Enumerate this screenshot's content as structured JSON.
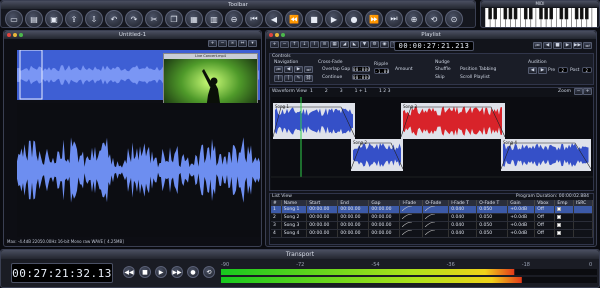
{
  "toolbar": {
    "title": "Toolbar",
    "icons": [
      "new-file",
      "open-file",
      "save",
      "export",
      "import",
      "undo",
      "redo",
      "cut",
      "copy",
      "paste",
      "delete",
      "back",
      "fast-back",
      "previous",
      "rewind",
      "stop",
      "play",
      "record",
      "fast-forward",
      "next",
      "forward",
      "loop",
      "zoom"
    ]
  },
  "midi": {
    "title": "MIDI"
  },
  "editor": {
    "title": "Untitled-1",
    "video_title": "Live Concert.mp4",
    "status": "Max: -4.4dB   22050.00Hz 16-bit Mono raw WAVE [ 4.25MB]"
  },
  "playlist": {
    "title": "Playlist",
    "time": "00:00:27:21.213",
    "controls": {
      "title": "Controls",
      "navigation": "Navigation",
      "crossfade": "Cross-Fade",
      "nudge": "Nudge",
      "audition": "Audition",
      "ripple": "Ripple",
      "overlap": "Overlap Gap",
      "continue": "Continue",
      "overlap_val": "00:000",
      "continue_val": "00:000",
      "gap_val": "-1.00",
      "amount": "Amount",
      "shuffle": "Shuffle",
      "repeat": "Repeat",
      "skip": "Skip",
      "position_tabbing": "Position Tabbing",
      "scroll_playlist": "Scroll Playlist",
      "preroll": "Pre",
      "postroll": "Post",
      "pre_val": "2",
      "post_val": "2"
    },
    "waveform_view": {
      "title": "Waveform View",
      "options": [
        "1",
        "2",
        "3",
        "1 + 1",
        "1 2 3"
      ],
      "zoom": "Zoom"
    },
    "songs": [
      "Song 1",
      "Song 2",
      "Song 3",
      "Song 4"
    ],
    "list_view": {
      "title": "List View",
      "duration": "Program Duration: 00:00:02.884",
      "columns": [
        "#",
        "Name",
        "Start",
        "End",
        "Gap",
        "I-Fade",
        "O-Fade",
        "I-Fade T",
        "O-Fade T",
        "Gain",
        "Vbox",
        "Emp",
        "ISRC"
      ],
      "rows": [
        {
          "num": "1",
          "name": "Song 1",
          "start": "00:00.00",
          "end": "00:00.00",
          "gap": "00:00.00",
          "ifade": "0.040",
          "ofade": "0.050",
          "gain": "+0.0dB",
          "vbox": "Off"
        },
        {
          "num": "2",
          "name": "Song 2",
          "start": "00:00.00",
          "end": "00:00.00",
          "gap": "00:00.00",
          "ifade": "0.040",
          "ofade": "0.050",
          "gain": "+0.0dB",
          "vbox": "Off"
        },
        {
          "num": "3",
          "name": "Song 3",
          "start": "00:00.00",
          "end": "00:00.00",
          "gap": "00:00.00",
          "ifade": "0.040",
          "ofade": "0.050",
          "gain": "+0.0dB",
          "vbox": "Off"
        },
        {
          "num": "4",
          "name": "Song 4",
          "start": "00:00.00",
          "end": "00:00.00",
          "gap": "00:00.00",
          "ifade": "0.040",
          "ofade": "0.050",
          "gain": "+0.0dB",
          "vbox": "Off"
        }
      ]
    }
  },
  "transport": {
    "title": "Transport",
    "time": "00:27:21:32.13",
    "scale": [
      "-90",
      "-72",
      "-54",
      "-36",
      "-18",
      "0"
    ],
    "meter_left": 0.78,
    "meter_right": 0.8
  }
}
